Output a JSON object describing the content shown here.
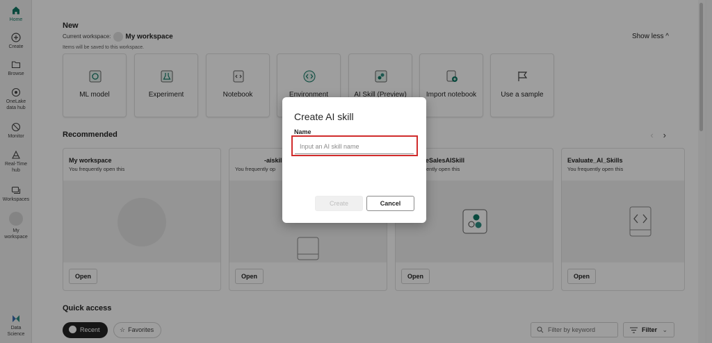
{
  "rail": {
    "items": [
      {
        "label": "Home"
      },
      {
        "label": "Create"
      },
      {
        "label": "Browse"
      },
      {
        "label": "OneLake data hub"
      },
      {
        "label": "Monitor"
      },
      {
        "label": "Real-Time hub"
      },
      {
        "label": "Workspaces"
      },
      {
        "label": "My workspace"
      }
    ],
    "bottom_label": "Data Science"
  },
  "new_section": {
    "title": "New",
    "current_ws_label": "Current workspace:",
    "current_ws_name": "My workspace",
    "note": "Items will be saved to this workspace.",
    "show_less": "Show less ^",
    "tiles": [
      {
        "label": "ML model",
        "icon": "ml-model-icon"
      },
      {
        "label": "Experiment",
        "icon": "experiment-icon"
      },
      {
        "label": "Notebook",
        "icon": "notebook-icon"
      },
      {
        "label": "Environment",
        "icon": "environment-icon"
      },
      {
        "label": "AI Skill (Preview)",
        "icon": "ai-skill-icon"
      },
      {
        "label": "Import notebook",
        "icon": "import-notebook-icon"
      },
      {
        "label": "Use a sample",
        "icon": "flag-icon"
      }
    ]
  },
  "recommended": {
    "title": "Recommended",
    "prev": "‹",
    "next": "›",
    "cards": [
      {
        "title": "My workspace",
        "sub": "You frequently open this",
        "open": "Open"
      },
      {
        "title": "-aiskil",
        "sub": "You frequently op",
        "open": "Open"
      },
      {
        "title": "ureSalesAISkill",
        "sub": "ently open this",
        "open": "Open"
      },
      {
        "title": "Evaluate_AI_Skills",
        "sub": "You frequently open this",
        "open": "Open"
      }
    ]
  },
  "quick_access": {
    "title": "Quick access",
    "recent": "Recent",
    "favorites": "Favorites",
    "filter_placeholder": "Filter by keyword",
    "filter_button": "Filter"
  },
  "dialog": {
    "title": "Create AI skill",
    "name_label": "Name",
    "name_placeholder": "Input an AI skill name",
    "name_value": "",
    "create": "Create",
    "cancel": "Cancel"
  },
  "colors": {
    "accent": "#117865",
    "highlight": "#d02b2b"
  }
}
